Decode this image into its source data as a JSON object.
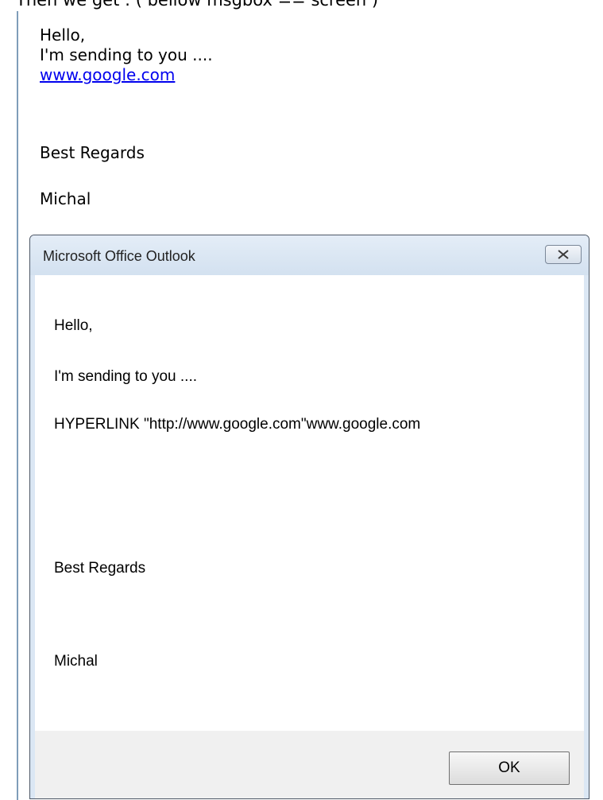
{
  "top_caption": "Then we get : ( bellow msgbox == screen )",
  "email": {
    "greeting": "Hello,",
    "line": "I'm sending to you ....",
    "link": "www.google.com",
    "closing": "Best Regards",
    "signature": "Michal"
  },
  "dialog": {
    "title": "Microsoft Office Outlook",
    "close_icon": "close-x-icon",
    "message": {
      "greeting": "Hello,",
      "line": "I'm sending to you ....",
      "hyperlink_field": "HYPERLINK \"http://www.google.com\"www.google.com",
      "closing": "Best Regards",
      "signature": "Michal"
    },
    "ok_label": "OK"
  },
  "colors": {
    "link": "#0000ee",
    "dialog_frame": "#dbe7f4",
    "button_area": "#f0f0f0"
  }
}
